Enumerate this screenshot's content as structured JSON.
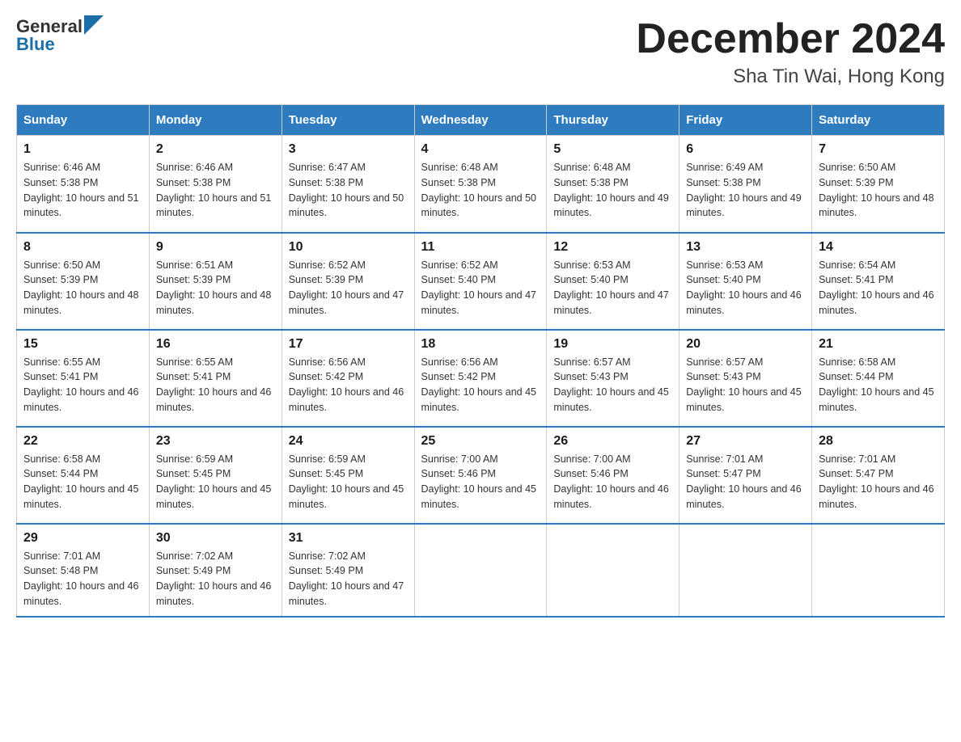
{
  "header": {
    "logo_general": "General",
    "logo_blue": "Blue",
    "month_title": "December 2024",
    "location": "Sha Tin Wai, Hong Kong"
  },
  "calendar": {
    "days_of_week": [
      "Sunday",
      "Monday",
      "Tuesday",
      "Wednesday",
      "Thursday",
      "Friday",
      "Saturday"
    ],
    "weeks": [
      [
        {
          "day": "1",
          "sunrise": "Sunrise: 6:46 AM",
          "sunset": "Sunset: 5:38 PM",
          "daylight": "Daylight: 10 hours and 51 minutes."
        },
        {
          "day": "2",
          "sunrise": "Sunrise: 6:46 AM",
          "sunset": "Sunset: 5:38 PM",
          "daylight": "Daylight: 10 hours and 51 minutes."
        },
        {
          "day": "3",
          "sunrise": "Sunrise: 6:47 AM",
          "sunset": "Sunset: 5:38 PM",
          "daylight": "Daylight: 10 hours and 50 minutes."
        },
        {
          "day": "4",
          "sunrise": "Sunrise: 6:48 AM",
          "sunset": "Sunset: 5:38 PM",
          "daylight": "Daylight: 10 hours and 50 minutes."
        },
        {
          "day": "5",
          "sunrise": "Sunrise: 6:48 AM",
          "sunset": "Sunset: 5:38 PM",
          "daylight": "Daylight: 10 hours and 49 minutes."
        },
        {
          "day": "6",
          "sunrise": "Sunrise: 6:49 AM",
          "sunset": "Sunset: 5:38 PM",
          "daylight": "Daylight: 10 hours and 49 minutes."
        },
        {
          "day": "7",
          "sunrise": "Sunrise: 6:50 AM",
          "sunset": "Sunset: 5:39 PM",
          "daylight": "Daylight: 10 hours and 48 minutes."
        }
      ],
      [
        {
          "day": "8",
          "sunrise": "Sunrise: 6:50 AM",
          "sunset": "Sunset: 5:39 PM",
          "daylight": "Daylight: 10 hours and 48 minutes."
        },
        {
          "day": "9",
          "sunrise": "Sunrise: 6:51 AM",
          "sunset": "Sunset: 5:39 PM",
          "daylight": "Daylight: 10 hours and 48 minutes."
        },
        {
          "day": "10",
          "sunrise": "Sunrise: 6:52 AM",
          "sunset": "Sunset: 5:39 PM",
          "daylight": "Daylight: 10 hours and 47 minutes."
        },
        {
          "day": "11",
          "sunrise": "Sunrise: 6:52 AM",
          "sunset": "Sunset: 5:40 PM",
          "daylight": "Daylight: 10 hours and 47 minutes."
        },
        {
          "day": "12",
          "sunrise": "Sunrise: 6:53 AM",
          "sunset": "Sunset: 5:40 PM",
          "daylight": "Daylight: 10 hours and 47 minutes."
        },
        {
          "day": "13",
          "sunrise": "Sunrise: 6:53 AM",
          "sunset": "Sunset: 5:40 PM",
          "daylight": "Daylight: 10 hours and 46 minutes."
        },
        {
          "day": "14",
          "sunrise": "Sunrise: 6:54 AM",
          "sunset": "Sunset: 5:41 PM",
          "daylight": "Daylight: 10 hours and 46 minutes."
        }
      ],
      [
        {
          "day": "15",
          "sunrise": "Sunrise: 6:55 AM",
          "sunset": "Sunset: 5:41 PM",
          "daylight": "Daylight: 10 hours and 46 minutes."
        },
        {
          "day": "16",
          "sunrise": "Sunrise: 6:55 AM",
          "sunset": "Sunset: 5:41 PM",
          "daylight": "Daylight: 10 hours and 46 minutes."
        },
        {
          "day": "17",
          "sunrise": "Sunrise: 6:56 AM",
          "sunset": "Sunset: 5:42 PM",
          "daylight": "Daylight: 10 hours and 46 minutes."
        },
        {
          "day": "18",
          "sunrise": "Sunrise: 6:56 AM",
          "sunset": "Sunset: 5:42 PM",
          "daylight": "Daylight: 10 hours and 45 minutes."
        },
        {
          "day": "19",
          "sunrise": "Sunrise: 6:57 AM",
          "sunset": "Sunset: 5:43 PM",
          "daylight": "Daylight: 10 hours and 45 minutes."
        },
        {
          "day": "20",
          "sunrise": "Sunrise: 6:57 AM",
          "sunset": "Sunset: 5:43 PM",
          "daylight": "Daylight: 10 hours and 45 minutes."
        },
        {
          "day": "21",
          "sunrise": "Sunrise: 6:58 AM",
          "sunset": "Sunset: 5:44 PM",
          "daylight": "Daylight: 10 hours and 45 minutes."
        }
      ],
      [
        {
          "day": "22",
          "sunrise": "Sunrise: 6:58 AM",
          "sunset": "Sunset: 5:44 PM",
          "daylight": "Daylight: 10 hours and 45 minutes."
        },
        {
          "day": "23",
          "sunrise": "Sunrise: 6:59 AM",
          "sunset": "Sunset: 5:45 PM",
          "daylight": "Daylight: 10 hours and 45 minutes."
        },
        {
          "day": "24",
          "sunrise": "Sunrise: 6:59 AM",
          "sunset": "Sunset: 5:45 PM",
          "daylight": "Daylight: 10 hours and 45 minutes."
        },
        {
          "day": "25",
          "sunrise": "Sunrise: 7:00 AM",
          "sunset": "Sunset: 5:46 PM",
          "daylight": "Daylight: 10 hours and 45 minutes."
        },
        {
          "day": "26",
          "sunrise": "Sunrise: 7:00 AM",
          "sunset": "Sunset: 5:46 PM",
          "daylight": "Daylight: 10 hours and 46 minutes."
        },
        {
          "day": "27",
          "sunrise": "Sunrise: 7:01 AM",
          "sunset": "Sunset: 5:47 PM",
          "daylight": "Daylight: 10 hours and 46 minutes."
        },
        {
          "day": "28",
          "sunrise": "Sunrise: 7:01 AM",
          "sunset": "Sunset: 5:47 PM",
          "daylight": "Daylight: 10 hours and 46 minutes."
        }
      ],
      [
        {
          "day": "29",
          "sunrise": "Sunrise: 7:01 AM",
          "sunset": "Sunset: 5:48 PM",
          "daylight": "Daylight: 10 hours and 46 minutes."
        },
        {
          "day": "30",
          "sunrise": "Sunrise: 7:02 AM",
          "sunset": "Sunset: 5:49 PM",
          "daylight": "Daylight: 10 hours and 46 minutes."
        },
        {
          "day": "31",
          "sunrise": "Sunrise: 7:02 AM",
          "sunset": "Sunset: 5:49 PM",
          "daylight": "Daylight: 10 hours and 47 minutes."
        },
        null,
        null,
        null,
        null
      ]
    ]
  }
}
